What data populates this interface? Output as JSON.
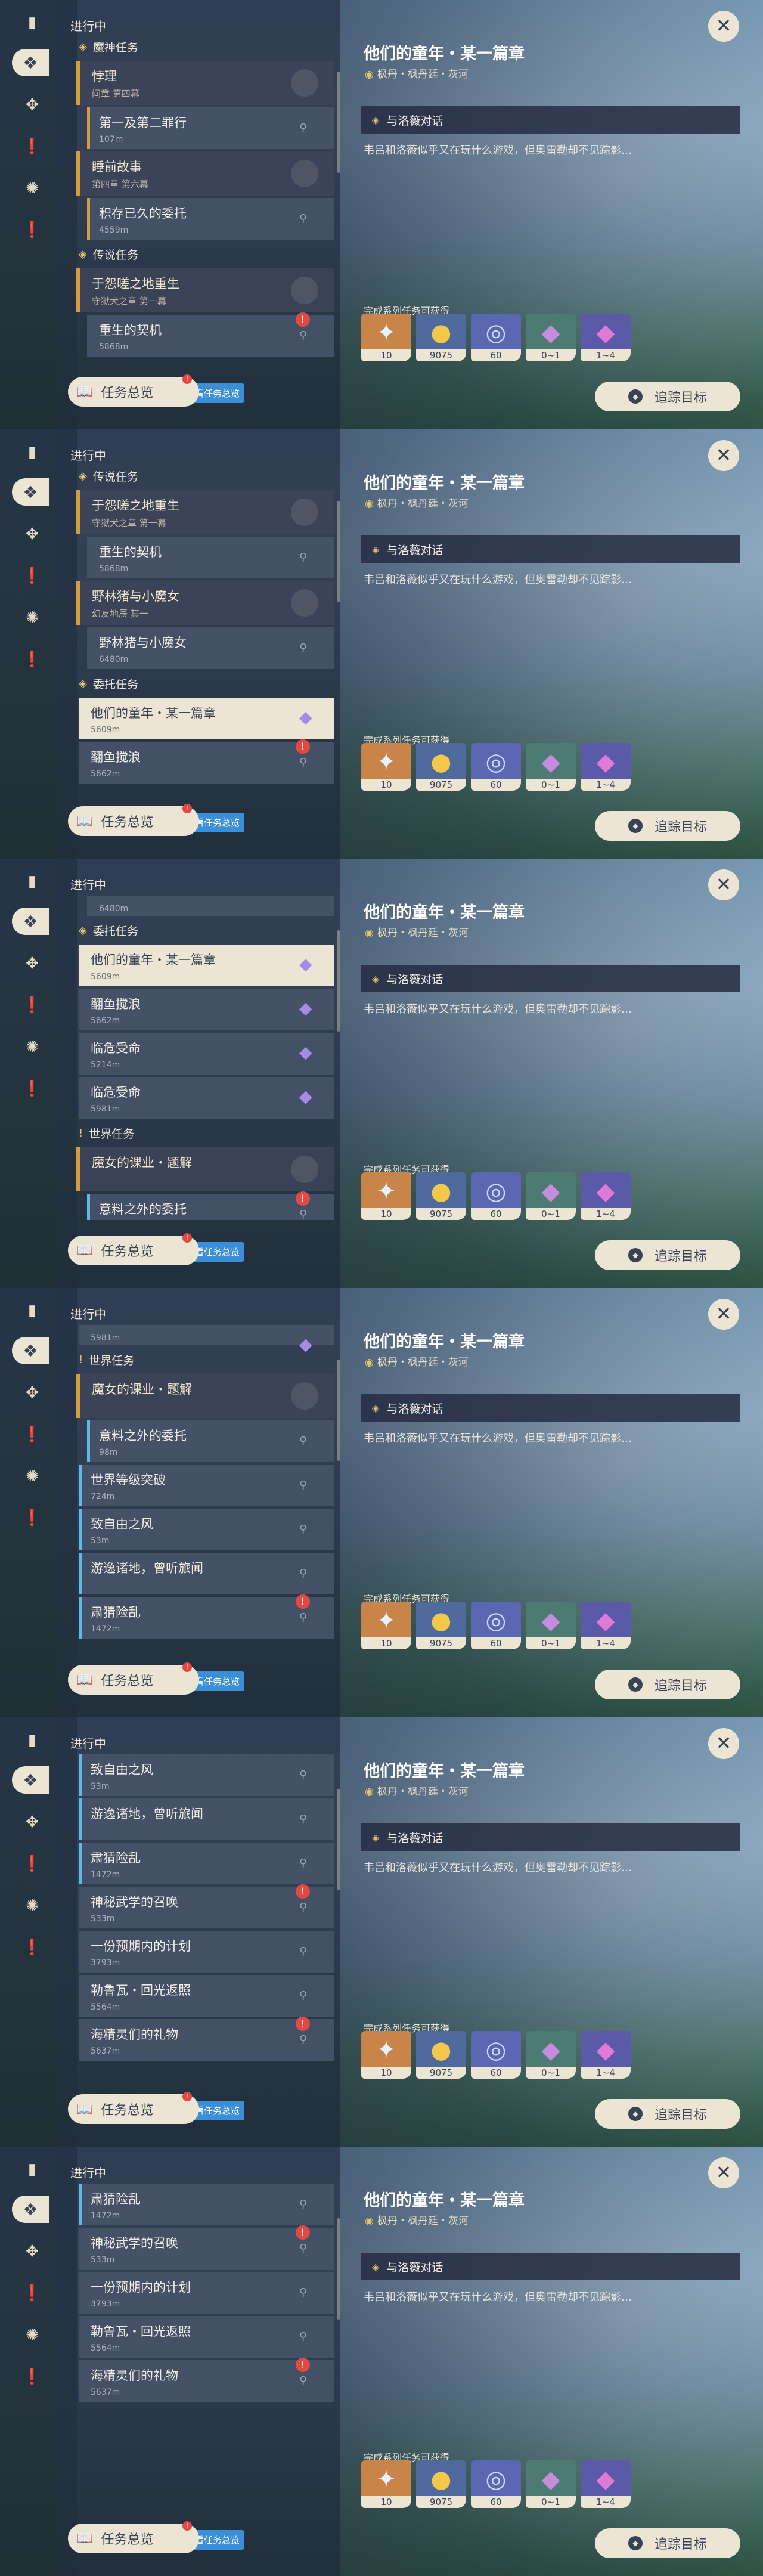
{
  "colors": {
    "accent": "#ece5d4",
    "gold": "#d59b3c",
    "blue": "#5fb8e6",
    "alert": "#e04a42"
  },
  "rail_icons": [
    "book-icon",
    "diamond-icon",
    "compass-icon",
    "exclamation-icon",
    "shuriken-icon",
    "exclamation-icon"
  ],
  "right": {
    "title": "他们的童年・某一篇章",
    "location": "枫丹・枫丹廷・灰河",
    "step": "与洛薇对话",
    "desc": "韦吕和洛薇似乎又在玩什么游戏，但奥雷勒却不见踪影…",
    "rewards_label": "完成系列任务可获得",
    "rewards": [
      {
        "icon": "✦",
        "qty": "10",
        "bg": "#c9844a",
        "color": "#e6f2ff"
      },
      {
        "icon": "●",
        "qty": "9075",
        "bg": "#4f6a9c",
        "color": "#f3c74a"
      },
      {
        "icon": "◎",
        "qty": "60",
        "bg": "#5a68b4",
        "color": "#c9d8ff"
      },
      {
        "icon": "◆",
        "qty": "0~1",
        "bg": "#4d7a72",
        "color": "#c58bdc"
      },
      {
        "icon": "◆",
        "qty": "1~4",
        "bg": "#5a5aa8",
        "color": "#e07ad8"
      }
    ],
    "track_label": "追踪目标",
    "close": "✕"
  },
  "bottom": {
    "overview": "任务总览",
    "hint": "查看任务总览",
    "icon": "📖"
  },
  "status": "进行中",
  "shots": [
    {
      "active_rail": 1,
      "rows": [
        {
          "k": "sec",
          "mark": "◈",
          "t": "魔神任务"
        },
        {
          "k": "grp",
          "t": "悖理",
          "s": "间章 第四幕"
        },
        {
          "k": "it",
          "deep": true,
          "bar": "gold",
          "t": "第一及第二罪行",
          "d": "107m"
        },
        {
          "k": "grp",
          "t": "睡前故事",
          "s": "第四章 第六幕"
        },
        {
          "k": "it",
          "deep": true,
          "bar": "gold",
          "t": "积存已久的委托",
          "d": "4559m"
        },
        {
          "k": "sec",
          "mark": "◈",
          "t": "传说任务"
        },
        {
          "k": "grp",
          "t": "于怨嗟之地重生",
          "s": "守狱犬之章 第一幕"
        },
        {
          "k": "it",
          "deep": true,
          "t": "重生的契机",
          "d": "5868m",
          "alert": true
        }
      ]
    },
    {
      "active_rail": 1,
      "rows": [
        {
          "k": "sec",
          "mark": "◈",
          "t": "传说任务"
        },
        {
          "k": "grp",
          "t": "于怨嗟之地重生",
          "s": "守狱犬之章 第一幕"
        },
        {
          "k": "it",
          "deep": true,
          "t": "重生的契机",
          "d": "5868m"
        },
        {
          "k": "grp",
          "t": "野林猪与小魔女",
          "s": "幻友地辰 其一"
        },
        {
          "k": "it",
          "deep": true,
          "t": "野林猪与小魔女",
          "d": "6480m"
        },
        {
          "k": "sec",
          "mark": "◈",
          "t": "委托任务"
        },
        {
          "k": "it",
          "sel": true,
          "gem": true,
          "t": "他们的童年・某一篇章",
          "d": "5609m"
        },
        {
          "k": "it",
          "t": "翻鱼搅浪",
          "d": "5662m",
          "alert": true
        }
      ]
    },
    {
      "active_rail": 1,
      "rows": [
        {
          "k": "it",
          "deep": true,
          "t": "",
          "d": "6480m",
          "short": true
        },
        {
          "k": "sec",
          "mark": "◈",
          "t": "委托任务"
        },
        {
          "k": "it",
          "sel": true,
          "gem": true,
          "t": "他们的童年・某一篇章",
          "d": "5609m"
        },
        {
          "k": "it",
          "gem": true,
          "t": "翻鱼搅浪",
          "d": "5662m"
        },
        {
          "k": "it",
          "gem": true,
          "t": "临危受命",
          "d": "5214m"
        },
        {
          "k": "it",
          "gem": true,
          "t": "临危受命",
          "d": "5981m"
        },
        {
          "k": "sec",
          "mark": "!",
          "t": "世界任务"
        },
        {
          "k": "grp",
          "t": "魔女的课业・题解",
          "s": ""
        },
        {
          "k": "it",
          "deep": true,
          "bar": "blue",
          "t": "意料之外的委托",
          "d": "98m",
          "alert": true
        }
      ]
    },
    {
      "active_rail": 1,
      "rows": [
        {
          "k": "it",
          "gem": true,
          "t": "",
          "d": "5981m",
          "short": true
        },
        {
          "k": "sec",
          "mark": "!",
          "t": "世界任务"
        },
        {
          "k": "grp",
          "t": "魔女的课业・题解",
          "s": ""
        },
        {
          "k": "it",
          "deep": true,
          "bar": "blue",
          "t": "意料之外的委托",
          "d": "98m"
        },
        {
          "k": "it",
          "bar": "blue",
          "t": "世界等级突破",
          "d": "724m"
        },
        {
          "k": "it",
          "bar": "blue",
          "t": "致自由之风",
          "d": "53m"
        },
        {
          "k": "it",
          "bar": "blue",
          "t": "游逸诸地，曾听旅闻",
          "d": ""
        },
        {
          "k": "it",
          "bar": "blue",
          "t": "肃猜险乱",
          "d": "1472m",
          "alert": true
        }
      ]
    },
    {
      "active_rail": 1,
      "rows": [
        {
          "k": "it",
          "bar": "blue",
          "t": "致自由之风",
          "d": "53m"
        },
        {
          "k": "it",
          "bar": "blue",
          "t": "游逸诸地，曾听旅闻",
          "d": ""
        },
        {
          "k": "it",
          "bar": "blue",
          "t": "肃猜险乱",
          "d": "1472m"
        },
        {
          "k": "it",
          "t": "神秘武学的召唤",
          "d": "533m",
          "alert": true
        },
        {
          "k": "it",
          "t": "一份预期内的计划",
          "d": "3793m"
        },
        {
          "k": "it",
          "t": "勒鲁瓦・回光返照",
          "d": "5564m"
        },
        {
          "k": "it",
          "t": "海精灵们的礼物",
          "d": "5637m",
          "alert": true
        }
      ]
    },
    {
      "active_rail": 1,
      "rows": [
        {
          "k": "it",
          "bar": "blue",
          "t": "肃猜险乱",
          "d": "1472m"
        },
        {
          "k": "it",
          "t": "神秘武学的召唤",
          "d": "533m",
          "alert": true
        },
        {
          "k": "it",
          "t": "一份预期内的计划",
          "d": "3793m"
        },
        {
          "k": "it",
          "t": "勒鲁瓦・回光返照",
          "d": "5564m"
        },
        {
          "k": "it",
          "t": "海精灵们的礼物",
          "d": "5637m",
          "alert": true
        }
      ]
    }
  ]
}
